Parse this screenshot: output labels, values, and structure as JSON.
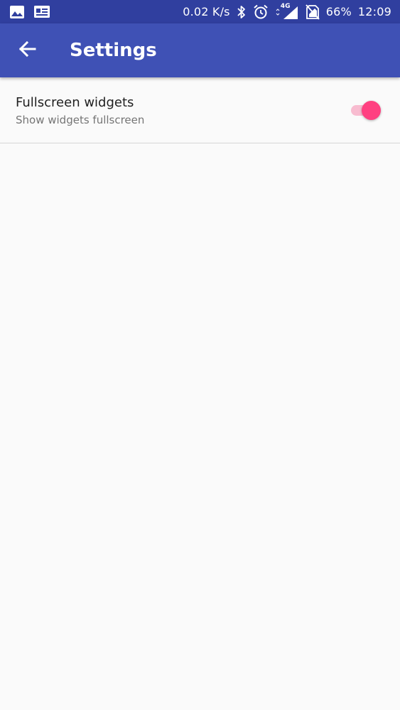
{
  "status_bar": {
    "net_speed": "0.02 K/s",
    "network_type": "4G",
    "battery": "66%",
    "time": "12:09",
    "icons": [
      "image-icon",
      "news-icon",
      "bluetooth-icon",
      "alarm-icon",
      "signal-icon",
      "no-sim-icon"
    ]
  },
  "app_bar": {
    "title": "Settings",
    "back_icon": "arrow-back-icon",
    "color": "#3f51b5"
  },
  "settings": {
    "items": [
      {
        "title": "Fullscreen widgets",
        "summary": "Show widgets fullscreen",
        "enabled": true,
        "accent_color": "#ff4081"
      }
    ]
  }
}
